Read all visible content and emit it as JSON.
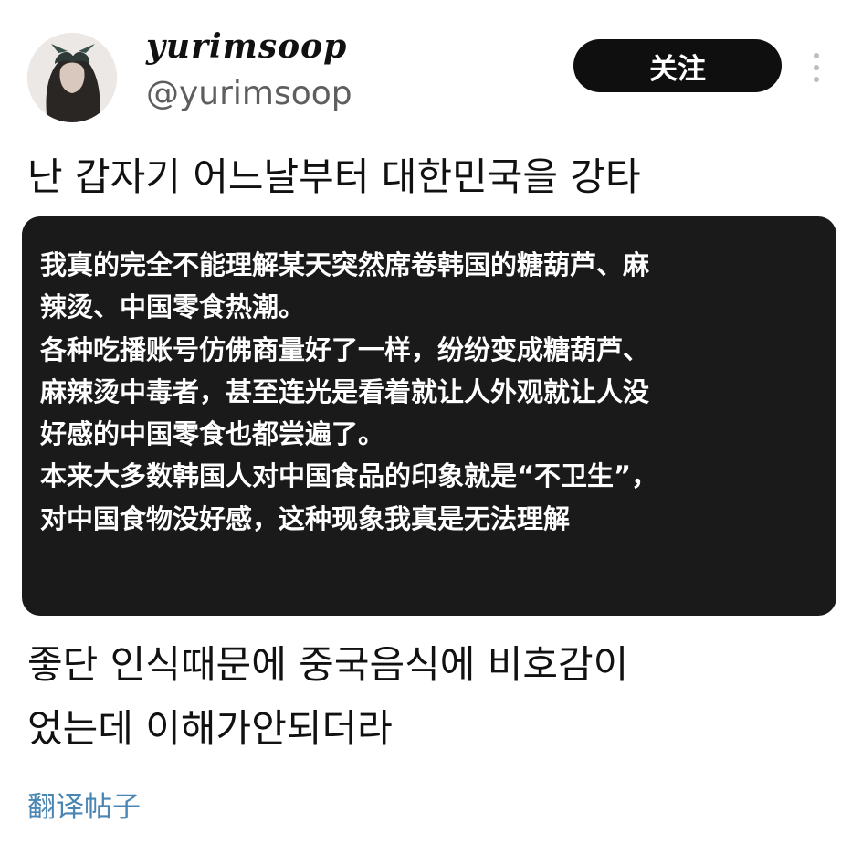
{
  "profile": {
    "display_name": "yurimsoop",
    "handle": "@yurimsoop",
    "follow_label": "关注"
  },
  "post": {
    "text_line1": "난 갑자기 어느날부터 대한민국을 강타",
    "quote_lines": [
      "我真的完全不能理解某天突然席卷韩国的糖葫芦、麻",
      "辣烫、中国零食热潮。",
      "各种吃播账号仿佛商量好了一样，纷纷变成糖葫芦、",
      "麻辣烫中毒者，甚至连光是看着就让人外观就让人没",
      "好感的中国零食也都尝遍了。",
      "本来大多数韩国人对中国食品的印象就是“不卫生”，",
      "对中国食物没好感，这种现象我真是无法理解"
    ],
    "text_line2": [
      "좋단 인식때문에 중국음식에 비호감이",
      "었는데 이해가안되더라"
    ],
    "translate_label": "翻译帖子"
  },
  "colors": {
    "follow_bg": "#0f0f0f",
    "quote_bg": "#1a1a1a",
    "link": "#4a86b3"
  },
  "icons": [
    "avatar-image",
    "more-vertical-icon"
  ]
}
